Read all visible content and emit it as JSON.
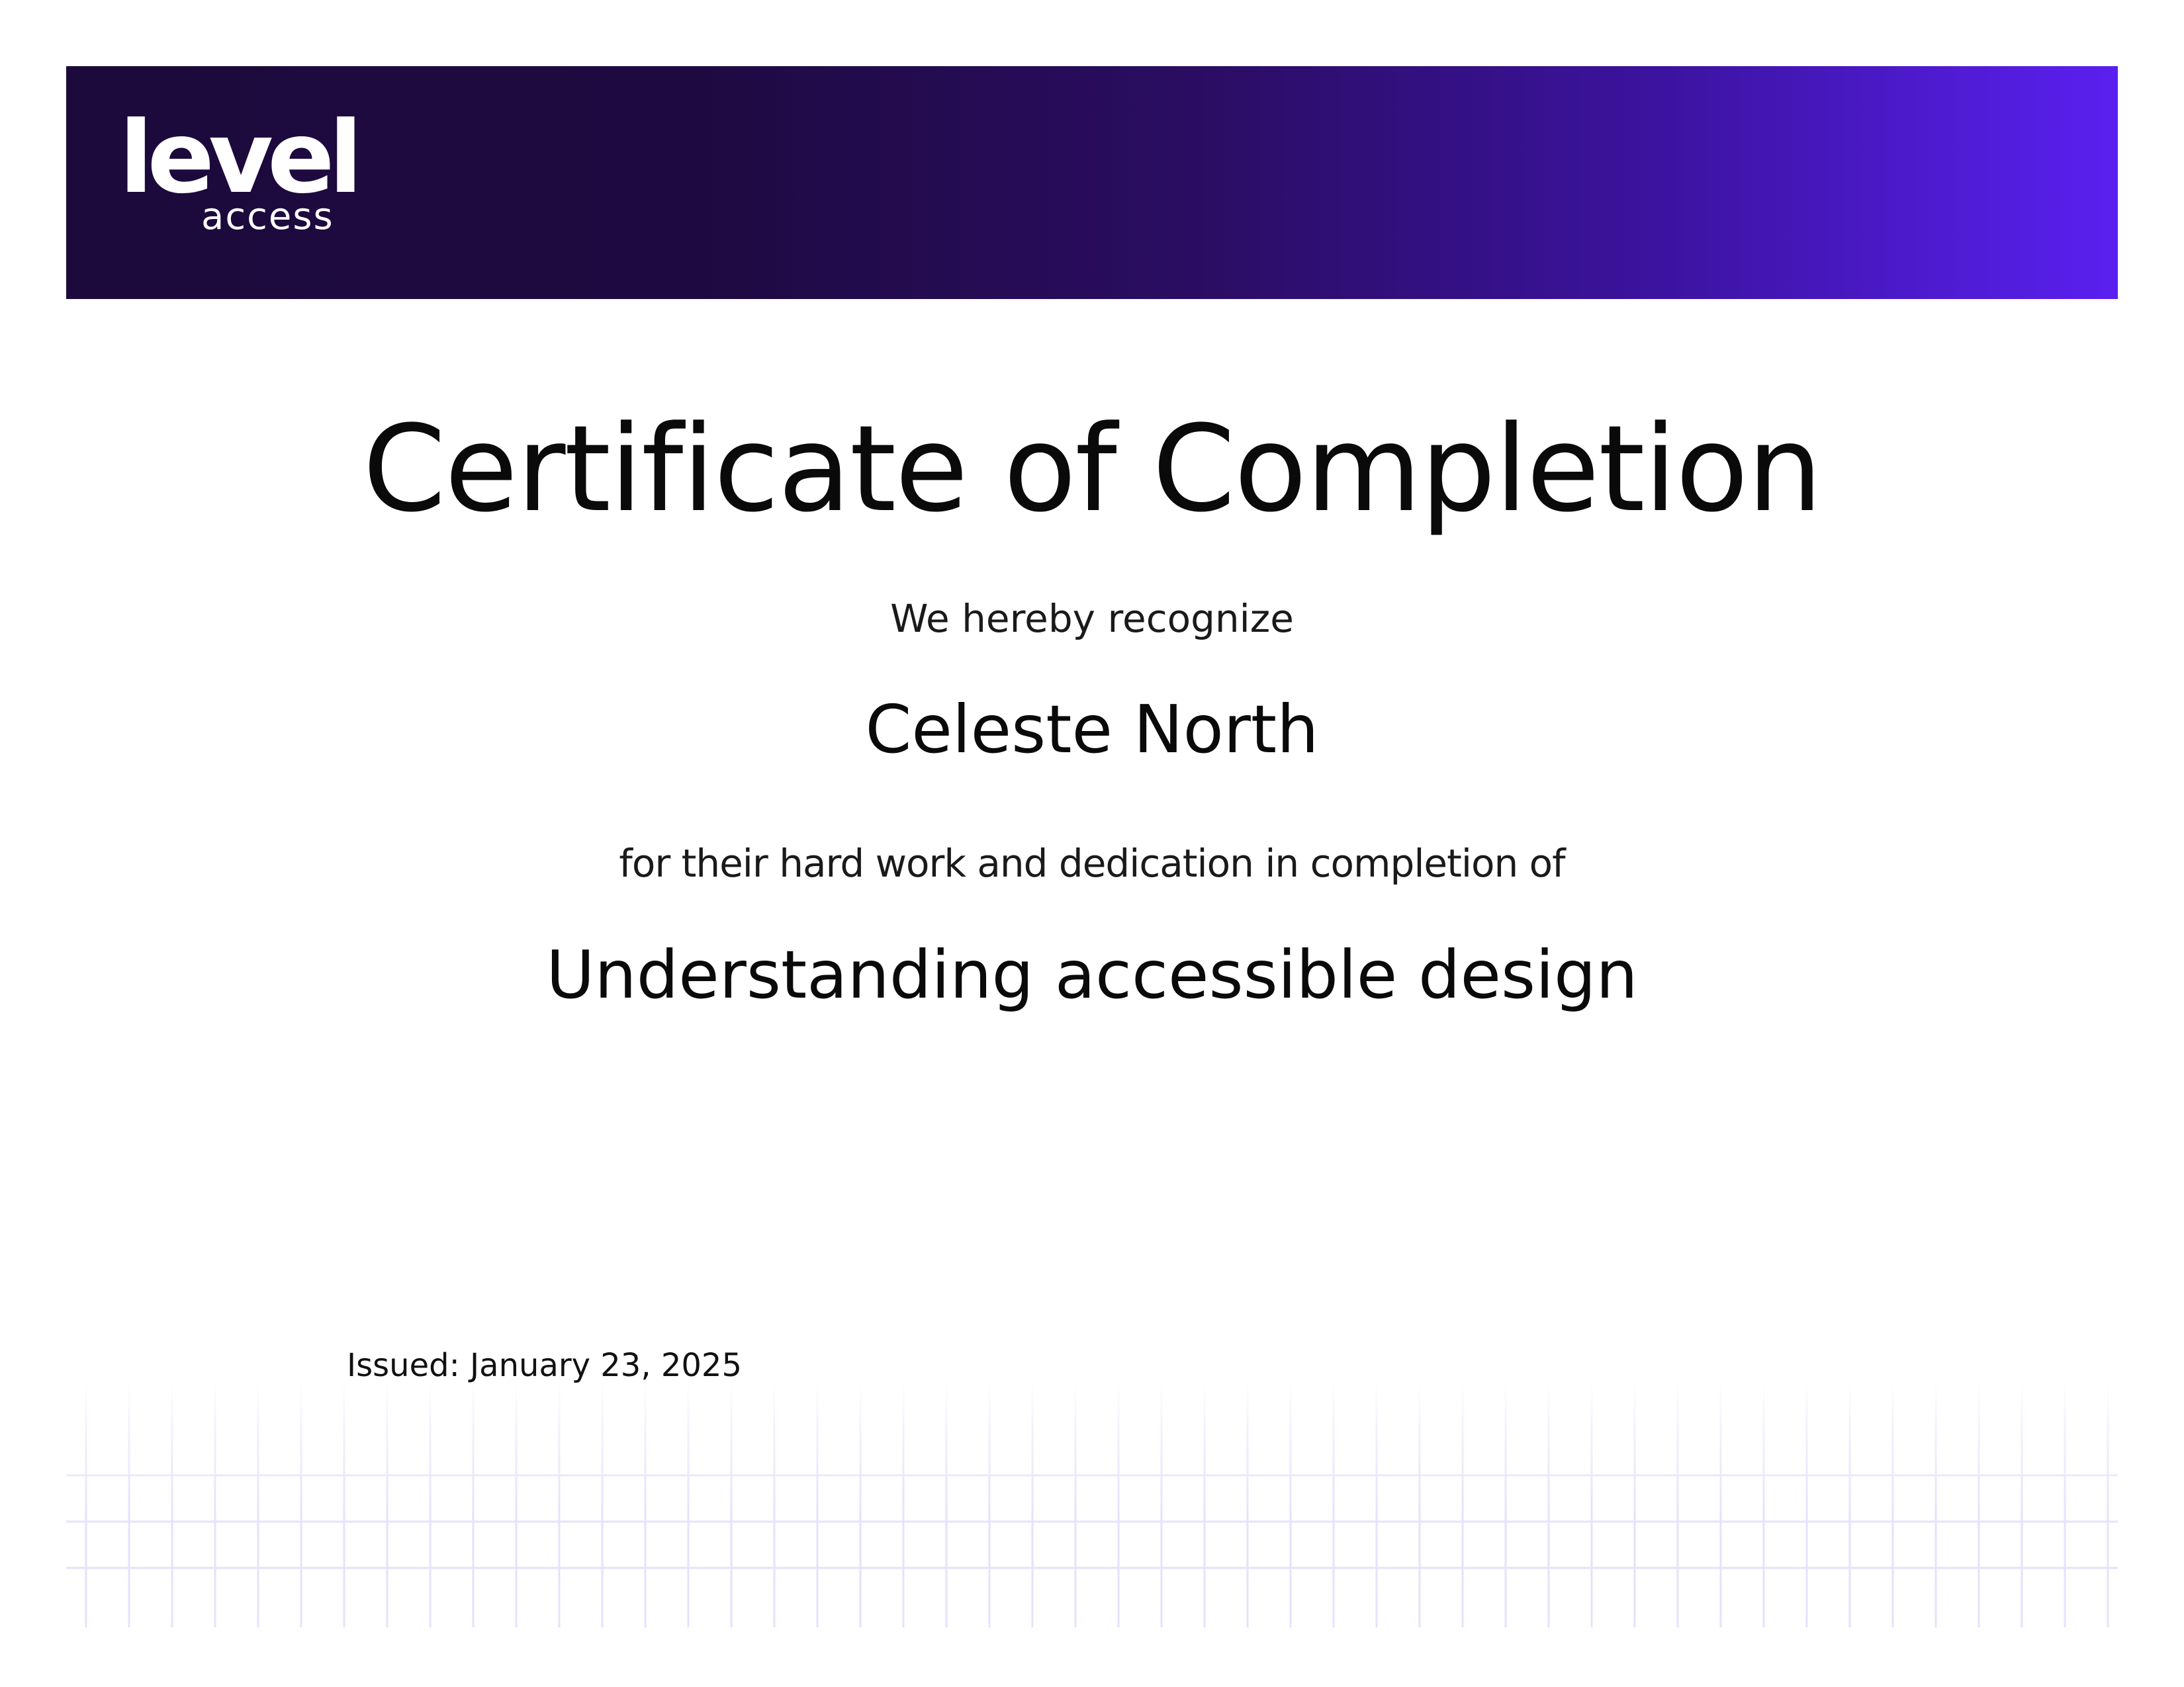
{
  "brand": {
    "logo_word": "level",
    "logo_sub": "access",
    "banner_colors": [
      "#1d0a3c",
      "#5a20f0"
    ]
  },
  "certificate": {
    "title": "Certificate of Completion",
    "intro": "We hereby recognize",
    "recipient": "Celeste North",
    "reason": "for their hard work and dedication in completion of",
    "course": "Understanding accessible design",
    "issued": "Issued: January 23, 2025"
  },
  "decoration": {
    "grid_color": "#e6e2fb"
  }
}
